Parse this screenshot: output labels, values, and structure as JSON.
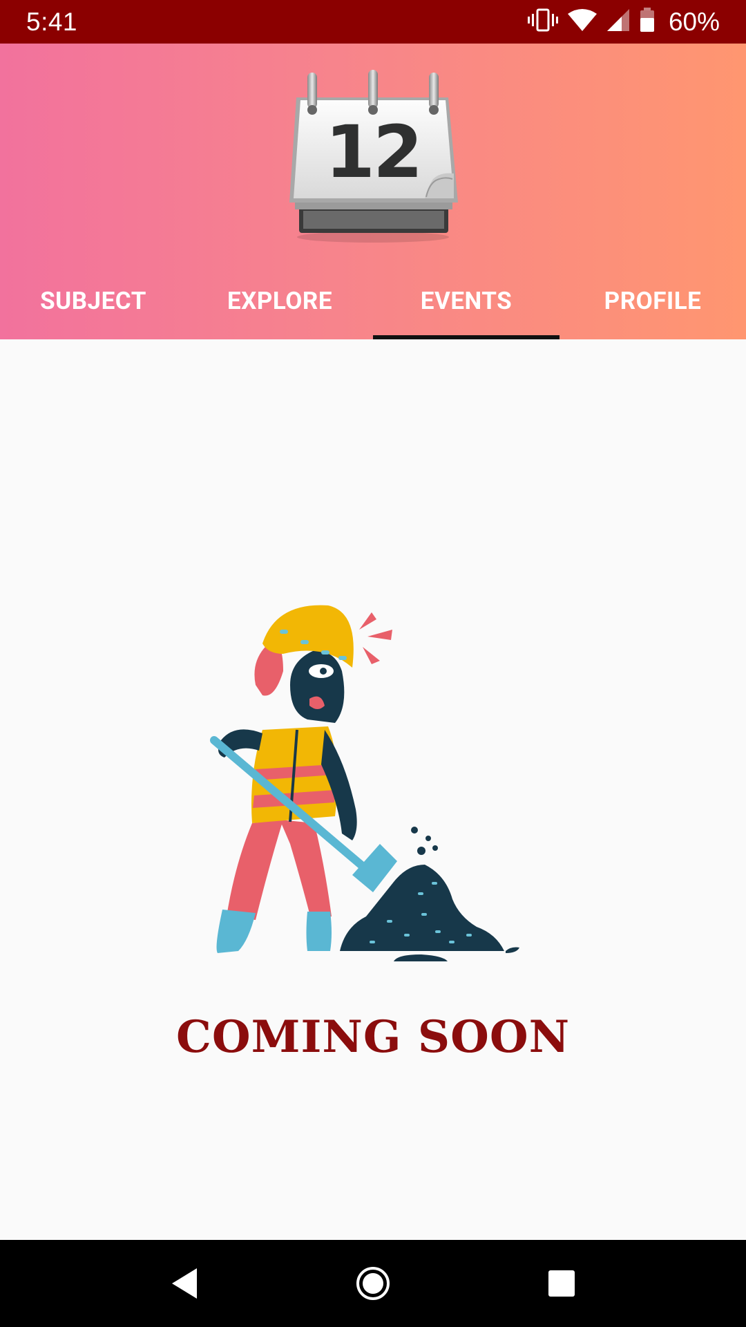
{
  "status_bar": {
    "time": "5:41",
    "battery_percent": "60%",
    "icons": [
      "vibrate-icon",
      "wifi-icon",
      "signal-icon",
      "battery-icon"
    ]
  },
  "header": {
    "calendar_day": "12",
    "tabs": [
      {
        "label": "SUBJECT",
        "selected": false
      },
      {
        "label": "EXPLORE",
        "selected": false
      },
      {
        "label": "EVENTS",
        "selected": true
      },
      {
        "label": "PROFILE",
        "selected": false
      }
    ]
  },
  "main": {
    "illustration": "construction-worker-digging-illustration",
    "message": "COMING SOON"
  },
  "nav_bar": {
    "buttons": [
      "back-icon",
      "home-icon",
      "recents-icon"
    ]
  },
  "colors": {
    "status_bar": "#8b0000",
    "header_gradient_start": "#f2729d",
    "header_gradient_end": "#ff9670",
    "message": "#8b0d0d",
    "tab_indicator": "#111111"
  }
}
